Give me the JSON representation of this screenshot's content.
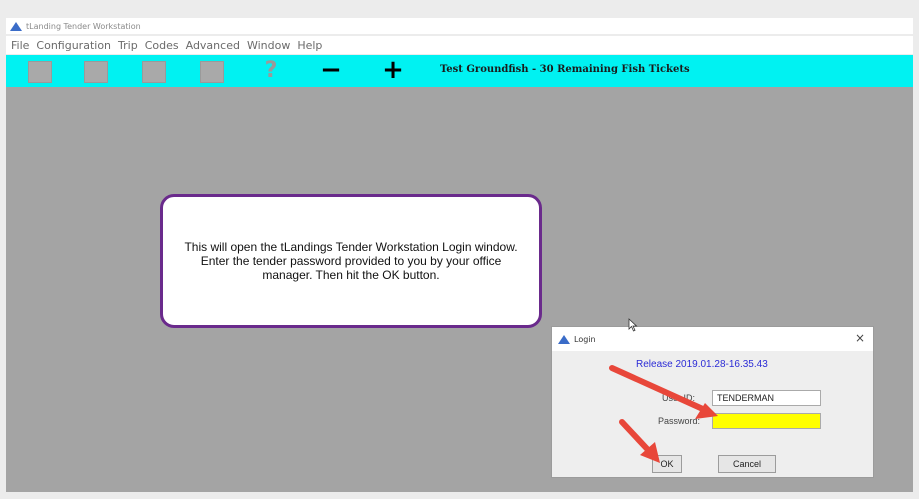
{
  "window": {
    "title": "tLanding Tender Workstation"
  },
  "menu": {
    "items": [
      "File",
      "Configuration",
      "Trip",
      "Codes",
      "Advanced",
      "Window",
      "Help"
    ]
  },
  "toolbar": {
    "buttons": [
      {
        "name": "new-icon"
      },
      {
        "name": "open-icon"
      },
      {
        "name": "save-icon"
      },
      {
        "name": "print-icon"
      },
      {
        "name": "help-icon",
        "glyph": "?"
      },
      {
        "name": "minus-icon",
        "glyph": "−"
      },
      {
        "name": "plus-icon",
        "glyph": "+"
      }
    ],
    "status": "Test Groundfish - 30 Remaining Fish Tickets",
    "background": "#00f2f2"
  },
  "callout": {
    "text": "This will open the tLandings Tender Workstation Login window. Enter the tender password provided to you by your office manager. Then hit the OK button.",
    "border_color": "#6a2a8c"
  },
  "login_dialog": {
    "title": "Login",
    "close": "×",
    "release": "Release 2019.01.28-16.35.43",
    "user_label": "User ID:",
    "user_value": "TENDERMAN",
    "password_label": "Password:",
    "password_value": "",
    "password_bg": "#ffff00",
    "ok_label": "OK",
    "cancel_label": "Cancel"
  },
  "annotation_arrows": {
    "color": "#e8473a"
  }
}
